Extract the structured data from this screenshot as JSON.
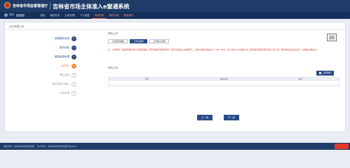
{
  "header": {
    "agency": "吉林省市场监督管理厅",
    "system_title": "吉林省市场主体准入e窗通系统"
  },
  "nav": {
    "user_greeting": "您好,",
    "items": [
      {
        "label": "首页"
      },
      {
        "label": "我的办件"
      },
      {
        "label": "业务办理"
      },
      {
        "label": "个人信息"
      },
      {
        "label": "申请材料"
      },
      {
        "label": "操作手册"
      },
      {
        "label": "联系我们"
      }
    ],
    "active_index": 4
  },
  "card": {
    "title": "企业申报上传"
  },
  "steps": [
    {
      "label": "填报基本信息",
      "num": "1",
      "state": "done"
    },
    {
      "label": "股东信息",
      "num": "2",
      "state": "done"
    },
    {
      "label": "董事监事经理",
      "num": "3",
      "state": "done"
    },
    {
      "label": "上传材料",
      "num": "4",
      "state": "current"
    },
    {
      "label": "确认信息",
      "num": "5",
      "state": "pending"
    },
    {
      "label": "提交申请人确认",
      "num": "6",
      "state": "pending"
    },
    {
      "label": "完成申报",
      "num": "7",
      "state": "pending"
    }
  ],
  "content": {
    "section_title": "材料上传",
    "options": [
      {
        "label": "下载材料模板",
        "selected": false
      },
      {
        "label": "上传扫描件",
        "selected": true
      },
      {
        "label": "上传电子材料",
        "selected": false
      }
    ],
    "notice": "注：上传要求：请按照材料清单上传完整材料，所有扫描件须清晰可辨，每页均需加盖公章或签字。上传文件格式支持JPG、PNG、PDF，单个文件大小不超过5M。如有疑问请联系登记机关工作人员，确认材料无误后点击下一步继续办理业务。",
    "upload_label": "材料上传",
    "upload_button": "上传材料",
    "table_headers": [
      "序号",
      "材料名称",
      "操作"
    ]
  },
  "buttons": {
    "prev": "上一步",
    "next": "下一步"
  },
  "footer": {
    "text": "版权所有：吉林省市场监督管理厅　技术支持：吉林省市场监督管理厅信息中心"
  }
}
